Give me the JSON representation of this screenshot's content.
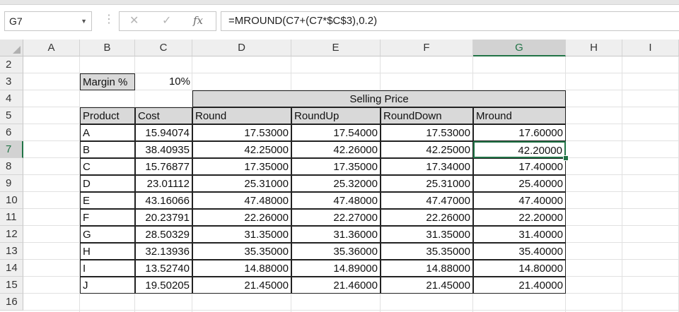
{
  "formula_bar": {
    "name_box": "G7",
    "cancel_glyph": "✕",
    "enter_glyph": "✓",
    "fx_label": "fx",
    "formula": "=MROUND(C7+(C7*$C$3),0.2)"
  },
  "columns": [
    "A",
    "B",
    "C",
    "D",
    "E",
    "F",
    "G",
    "H",
    "I"
  ],
  "rows": [
    "2",
    "3",
    "4",
    "5",
    "6",
    "7",
    "8",
    "9",
    "10",
    "11",
    "12",
    "13",
    "14",
    "15",
    "16"
  ],
  "selected": {
    "column": "G",
    "row": "7"
  },
  "margin": {
    "label": "Margin %",
    "value": "10%"
  },
  "group_header": "Selling Price",
  "headers": [
    "Product",
    "Cost",
    "Round",
    "RoundUp",
    "RoundDown",
    "Mround"
  ],
  "table": [
    [
      "A",
      "15.94074",
      "17.53000",
      "17.54000",
      "17.53000",
      "17.60000"
    ],
    [
      "B",
      "38.40935",
      "42.25000",
      "42.26000",
      "42.25000",
      "42.20000"
    ],
    [
      "C",
      "15.76877",
      "17.35000",
      "17.35000",
      "17.34000",
      "17.40000"
    ],
    [
      "D",
      "23.01112",
      "25.31000",
      "25.32000",
      "25.31000",
      "25.40000"
    ],
    [
      "E",
      "43.16066",
      "47.48000",
      "47.48000",
      "47.47000",
      "47.40000"
    ],
    [
      "F",
      "20.23791",
      "22.26000",
      "22.27000",
      "22.26000",
      "22.20000"
    ],
    [
      "G",
      "28.50329",
      "31.35000",
      "31.36000",
      "31.35000",
      "31.40000"
    ],
    [
      "H",
      "32.13936",
      "35.35000",
      "35.36000",
      "35.35000",
      "35.40000"
    ],
    [
      "I",
      "13.52740",
      "14.88000",
      "14.89000",
      "14.88000",
      "14.80000"
    ],
    [
      "J",
      "19.50205",
      "21.45000",
      "21.46000",
      "21.45000",
      "21.40000"
    ]
  ],
  "colors": {
    "accent": "#217346",
    "header_fill": "#d9d9d9"
  }
}
